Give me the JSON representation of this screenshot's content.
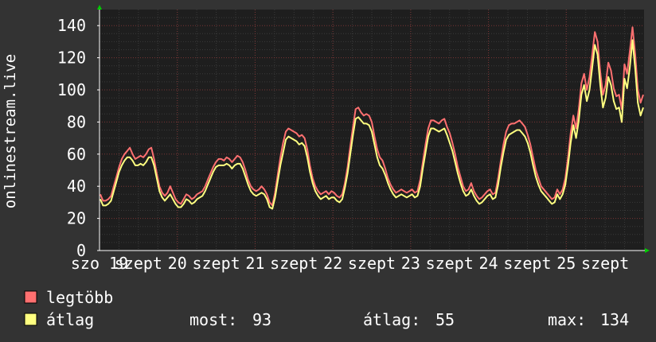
{
  "chart_data": {
    "type": "line",
    "ylabel": "onlinestream.live",
    "ylim": [
      0,
      150
    ],
    "yticks": [
      0,
      20,
      40,
      60,
      80,
      100,
      120,
      140
    ],
    "x_tick_labels": [
      "szo 19",
      "szept",
      "20",
      "szept",
      "21",
      "szept",
      "22",
      "szept",
      "23",
      "szept",
      "24",
      "szept",
      "25",
      "szept"
    ],
    "grid": true,
    "colors": {
      "background": "#333333",
      "plot_background": "#1e1e1e",
      "grid_minor": "#3a3a3a",
      "grid_major": "#7a3535",
      "legtobb": "#ff7070",
      "atlag": "#ffff80",
      "axis_arrow": "#00cc00"
    },
    "series": [
      {
        "name": "legtöbb",
        "values": [
          35,
          31,
          31,
          32,
          34,
          40,
          46,
          52,
          57,
          60,
          62,
          64,
          60,
          57,
          58,
          59,
          58,
          60,
          63,
          64,
          57,
          48,
          40,
          36,
          34,
          36,
          40,
          36,
          32,
          30,
          29,
          32,
          35,
          34,
          32,
          33,
          35,
          36,
          37,
          40,
          44,
          48,
          52,
          55,
          57,
          57,
          56,
          58,
          57,
          55,
          57,
          59,
          58,
          55,
          50,
          44,
          40,
          38,
          37,
          38,
          40,
          38,
          35,
          30,
          28,
          36,
          47,
          58,
          67,
          74,
          76,
          75,
          74,
          73,
          71,
          72,
          70,
          63,
          53,
          45,
          40,
          37,
          35,
          36,
          37,
          35,
          37,
          36,
          34,
          33,
          35,
          42,
          52,
          65,
          77,
          88,
          89,
          86,
          84,
          85,
          84,
          80,
          71,
          63,
          58,
          56,
          51,
          45,
          41,
          38,
          36,
          37,
          38,
          37,
          36,
          37,
          38,
          36,
          37,
          44,
          55,
          66,
          76,
          81,
          81,
          80,
          79,
          81,
          82,
          77,
          73,
          67,
          60,
          52,
          46,
          40,
          37,
          38,
          42,
          37,
          34,
          32,
          33,
          35,
          37,
          38,
          35,
          36,
          45,
          56,
          66,
          74,
          78,
          79,
          79,
          80,
          81,
          79,
          77,
          72,
          66,
          58,
          50,
          45,
          40,
          38,
          36,
          34,
          32,
          33,
          38,
          35,
          38,
          45,
          58,
          73,
          84,
          76,
          88,
          104,
          110,
          100,
          108,
          122,
          136,
          130,
          111,
          97,
          103,
          117,
          112,
          101,
          96,
          97,
          88,
          116,
          110,
          124,
          139,
          122,
          100,
          92,
          97
        ]
      },
      {
        "name": "átlag",
        "values": [
          32,
          28,
          28,
          29,
          31,
          37,
          43,
          49,
          53,
          56,
          58,
          58,
          56,
          53,
          53,
          54,
          53,
          55,
          58,
          58,
          53,
          45,
          37,
          33,
          31,
          33,
          35,
          32,
          29,
          27,
          27,
          29,
          32,
          31,
          29,
          30,
          32,
          33,
          34,
          37,
          41,
          45,
          49,
          52,
          53,
          53,
          53,
          54,
          53,
          51,
          53,
          54,
          54,
          51,
          46,
          41,
          37,
          35,
          34,
          35,
          36,
          35,
          32,
          27,
          26,
          33,
          43,
          53,
          61,
          69,
          71,
          70,
          69,
          68,
          66,
          67,
          65,
          58,
          49,
          42,
          37,
          34,
          32,
          33,
          34,
          32,
          33,
          33,
          31,
          30,
          32,
          39,
          48,
          60,
          72,
          82,
          83,
          81,
          79,
          79,
          78,
          74,
          66,
          58,
          53,
          51,
          47,
          42,
          38,
          35,
          33,
          34,
          35,
          34,
          33,
          34,
          35,
          33,
          34,
          40,
          51,
          61,
          71,
          76,
          76,
          75,
          74,
          75,
          76,
          72,
          67,
          62,
          55,
          48,
          42,
          37,
          34,
          35,
          38,
          34,
          31,
          29,
          30,
          32,
          34,
          35,
          32,
          33,
          41,
          52,
          61,
          69,
          72,
          73,
          74,
          75,
          75,
          73,
          71,
          67,
          61,
          53,
          46,
          41,
          37,
          35,
          33,
          31,
          29,
          30,
          35,
          32,
          35,
          41,
          53,
          67,
          78,
          70,
          81,
          97,
          103,
          93,
          100,
          114,
          128,
          122,
          103,
          89,
          95,
          108,
          103,
          93,
          88,
          89,
          80,
          107,
          101,
          114,
          131,
          113,
          92,
          84,
          89
        ]
      }
    ]
  },
  "legend": {
    "items": [
      {
        "label": "legtöbb"
      },
      {
        "label": "átlag"
      }
    ],
    "stats": {
      "most_label": "most:",
      "most_value": "93",
      "atlag_label": "átlag:",
      "atlag_value": "55",
      "max_label": "max:",
      "max_value": "134"
    }
  }
}
